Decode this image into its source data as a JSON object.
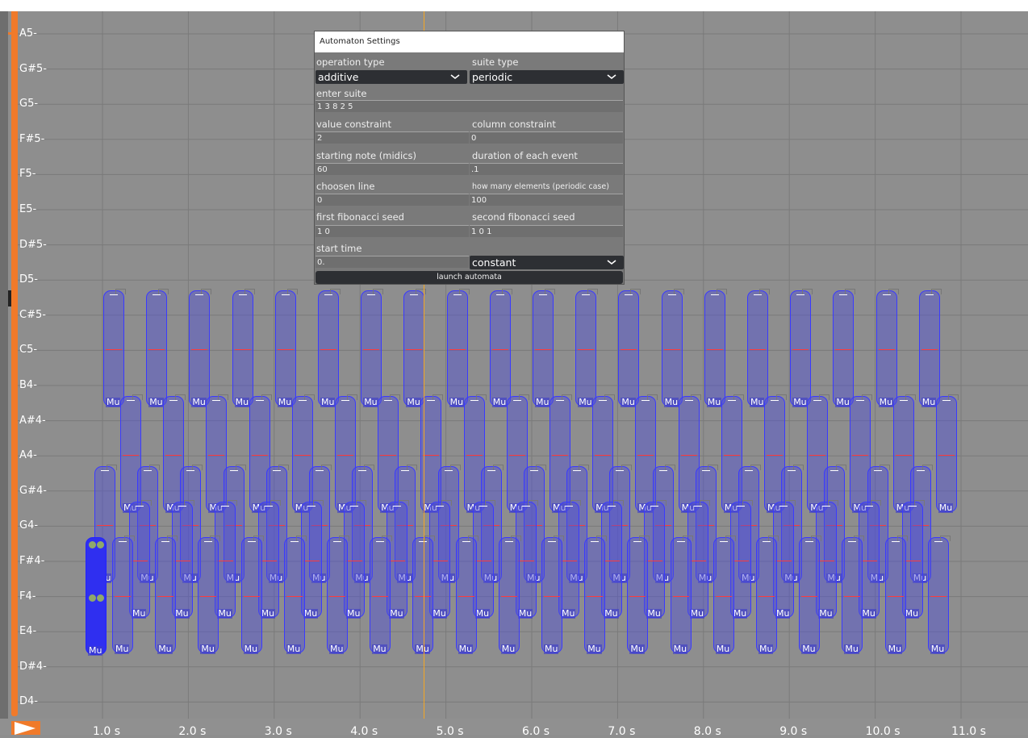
{
  "pitch_labels": [
    "A5-",
    "G#5-",
    "G5-",
    "F#5-",
    "F5-",
    "E5-",
    "D#5-",
    "D5-",
    "C#5-",
    "C5-",
    "B4-",
    "A#4-",
    "A4-",
    "G#4-",
    "G4-",
    "F#4-",
    "F4-",
    "E4-",
    "D#4-",
    "D4-"
  ],
  "time_labels": [
    "1.0 s",
    "2.0 s",
    "3.0 s",
    "4.0 s",
    "5.0 s",
    "6.0 s",
    "7.0 s",
    "8.0 s",
    "9.0 s",
    "10.0 s",
    "11.0 s"
  ],
  "note_label": "Mu",
  "colors": {
    "background": "#8e8e8e",
    "grid": "#7c7c7c",
    "note_fill": "#5050d7",
    "note_border": "#3a3aff",
    "accent_orange": "#f07a2a",
    "cursor": "#f5a623",
    "dialog_bg": "#7a7a7a",
    "control_dark": "#2d2f33"
  },
  "dialog": {
    "title": "Automaton Settings",
    "operation_type_label": "operation type",
    "operation_type_value": "additive",
    "suite_type_label": "suite type",
    "suite_type_value": "periodic",
    "enter_suite_label": "enter suite",
    "enter_suite_value": "1 3 8 2 5",
    "value_constraint_label": "value constraint",
    "value_constraint_value": "2",
    "column_constraint_label": "column constraint",
    "column_constraint_value": "0",
    "starting_note_label": "starting note (midics)",
    "starting_note_value": "60",
    "duration_label": "duration of each event",
    "duration_value": ".1",
    "chosen_line_label": "choosen line",
    "chosen_line_value": "0",
    "how_many_label": "how many elements (periodic case)",
    "how_many_value": "100",
    "first_seed_label": "first fibonacci seed",
    "first_seed_value": "1 0",
    "second_seed_label": "second fibonacci seed",
    "second_seed_value": "1 0 1",
    "start_time_label": "start time",
    "start_time_value": "0.",
    "mode_select_value": "constant",
    "launch_label": "launch automata"
  },
  "icons": {
    "play": "play-triangle-icon",
    "dropdown": "chevron-down-icon"
  }
}
